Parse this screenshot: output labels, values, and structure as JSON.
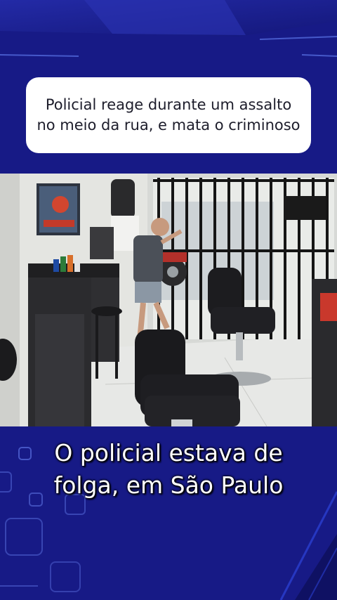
{
  "headline": {
    "text": "Policial reage durante um assalto no meio da rua, e mata o criminoso"
  },
  "caption": {
    "line1": "O policial estava de",
    "line2": "folga, em São Paulo"
  },
  "colors": {
    "background": "#171a86",
    "accent_line": "#5a74e8",
    "card": "#ffffff",
    "headline_text": "#1d1d2b",
    "caption_text": "#ffffff"
  },
  "video": {
    "description_icon": "video-frame-image"
  }
}
